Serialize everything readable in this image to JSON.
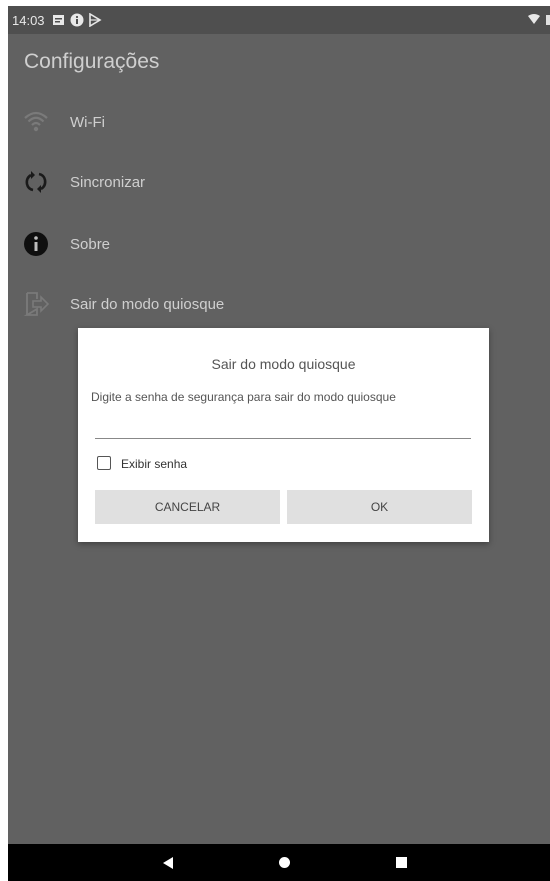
{
  "status_bar": {
    "time": "14:03",
    "icons": [
      "notification-icon",
      "info-icon",
      "play-store-icon",
      "wifi-icon",
      "battery-icon"
    ]
  },
  "screen": {
    "title": "Configurações",
    "items": [
      {
        "label": "Wi-Fi",
        "icon": "wifi-icon"
      },
      {
        "label": "Sincronizar",
        "icon": "sync-icon"
      },
      {
        "label": "Sobre",
        "icon": "info-icon"
      },
      {
        "label": "Sair do modo quiosque",
        "icon": "exit-icon"
      }
    ]
  },
  "dialog": {
    "title": "Sair do modo quiosque",
    "message": "Digite a senha de segurança para sair do modo quiosque",
    "password_value": "",
    "show_password_label": "Exibir senha",
    "show_password_checked": false,
    "cancel_label": "CANCELAR",
    "ok_label": "OK"
  },
  "nav_bar": {
    "buttons": [
      "back-icon",
      "home-icon",
      "recents-icon"
    ]
  },
  "colors": {
    "overlay_background": "#616161",
    "dialog_background": "#ffffff",
    "button_background": "#e0e0e0"
  }
}
